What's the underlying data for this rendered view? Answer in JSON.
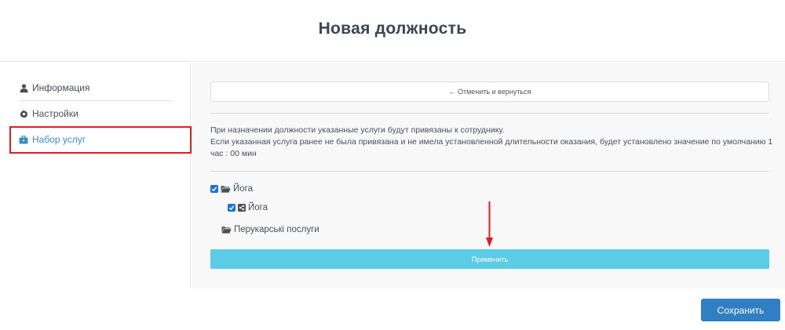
{
  "header": {
    "title": "Новая должность"
  },
  "sidebar": {
    "items": [
      {
        "label": "Информация",
        "icon": "user-icon"
      },
      {
        "label": "Настройки",
        "icon": "gear-icon"
      },
      {
        "label": "Набор услуг",
        "icon": "briefcase-icon",
        "active": true
      }
    ]
  },
  "content": {
    "cancel_label": "← Отменить и вернуться",
    "info_line1": "При назначении должности указанные услуги будут привязаны к сотруднику.",
    "info_line2": "Если указанная услуга ранее не была привязана и не имела установленной длительности оказания, будет установлено значение по умолчанию 1 час : 00 мин",
    "tree": [
      {
        "label": "Йога",
        "type": "folder",
        "checked": true
      },
      {
        "label": "Йога",
        "type": "service",
        "checked": true
      },
      {
        "label": "Перукарські послуги",
        "type": "folder",
        "checked": false
      }
    ],
    "apply_label": "Применить"
  },
  "footer": {
    "save_label": "Сохранить"
  },
  "colors": {
    "accent": "#3a8fc7",
    "apply_button": "#5bcbe6",
    "save_button": "#2f7fc2",
    "annotation": "#e11b22",
    "checkbox": "#1a73d9"
  }
}
